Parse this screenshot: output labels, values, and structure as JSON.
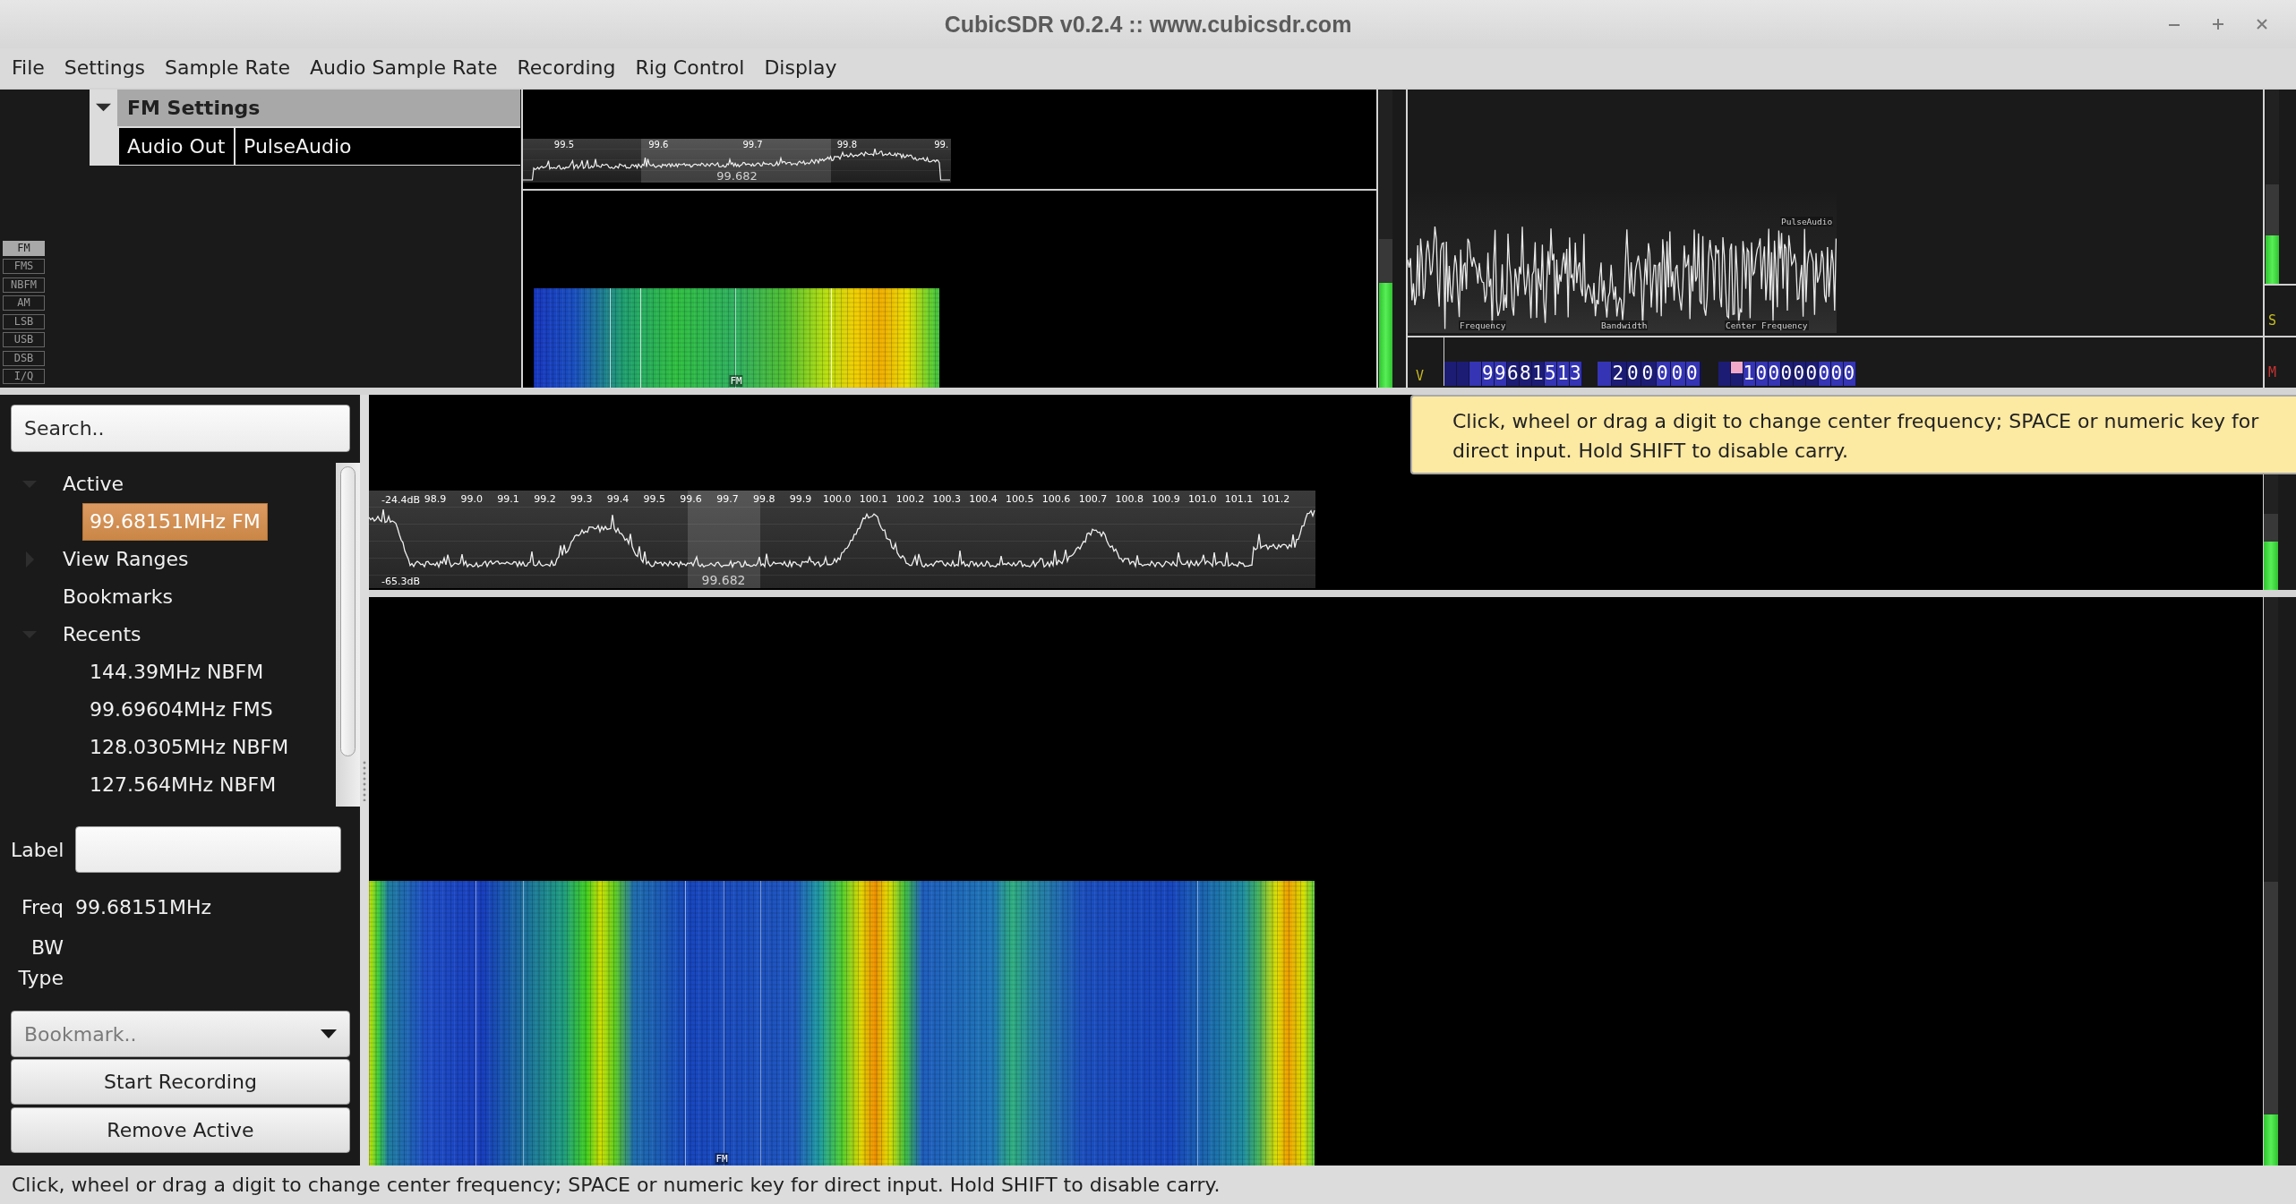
{
  "window": {
    "title": "CubicSDR v0.2.4 :: www.cubicsdr.com"
  },
  "menu": [
    "File",
    "Settings",
    "Sample Rate",
    "Audio Sample Rate",
    "Recording",
    "Rig Control",
    "Display"
  ],
  "demodulator": {
    "modes": [
      {
        "label": "FM",
        "selected": true
      },
      {
        "label": "FMS",
        "selected": false
      },
      {
        "label": "NBFM",
        "selected": false
      },
      {
        "label": "AM",
        "selected": false
      },
      {
        "label": "LSB",
        "selected": false
      },
      {
        "label": "USB",
        "selected": false
      },
      {
        "label": "DSB",
        "selected": false
      },
      {
        "label": "I/Q",
        "selected": false
      }
    ],
    "settings": {
      "title": "FM Settings",
      "expanded": true,
      "rows": [
        {
          "name": "Audio Out",
          "value": "PulseAudio"
        }
      ]
    },
    "spectrum": {
      "ticks": [
        "99.5",
        "99.6",
        "99.7",
        "99.8",
        "99."
      ],
      "center_label": "99.682"
    },
    "waterfall": {
      "marker": "FM"
    },
    "gain_meter": {
      "signal": {
        "level": 0.35
      },
      "setting": {
        "level": 0.5
      }
    },
    "scope": {
      "device": "PulseAudio",
      "labels": [
        "Frequency",
        "Bandwidth",
        "Center Frequency"
      ]
    },
    "toggle_label": "V",
    "displays": [
      {
        "kind": "frequency",
        "value": "99681513",
        "hovered": false
      },
      {
        "kind": "bandwidth",
        "value": "200000",
        "hovered": false
      },
      {
        "kind": "center",
        "value": "100000000",
        "hovered": true
      }
    ],
    "side_meter": {
      "signal": {
        "level": 0.25
      },
      "setting": {
        "level": 0.51
      }
    },
    "side_buttons": [
      {
        "label": "S",
        "color": "#c8c020"
      },
      {
        "label": "M",
        "color": "#c83232"
      }
    ]
  },
  "bookmarks": {
    "search": {
      "placeholder": "Search.."
    },
    "tree": [
      {
        "label": "Active",
        "expanded": true,
        "selected": false,
        "children": [
          {
            "label": "99.68151MHz FM",
            "selected": true
          }
        ]
      },
      {
        "label": "View Ranges",
        "expanded": false,
        "selected": false
      },
      {
        "label": "Bookmarks",
        "selected": false
      },
      {
        "label": "Recents",
        "expanded": true,
        "selected": false,
        "children": [
          {
            "label": "144.39MHz NBFM",
            "selected": false
          },
          {
            "label": "99.69604MHz FMS",
            "selected": false
          },
          {
            "label": "128.0305MHz NBFM",
            "selected": false
          },
          {
            "label": "127.564MHz NBFM",
            "selected": false
          }
        ]
      }
    ],
    "label_field": {
      "label": "Label"
    },
    "info": [
      {
        "label": "Freq",
        "value": "99.68151MHz"
      },
      {
        "label": "BW"
      },
      {
        "label": "Type"
      }
    ],
    "bookmark_menu": {
      "value": "Bookmark..",
      "disabled": true
    },
    "buttons": [
      "Start Recording",
      "Remove Active"
    ]
  },
  "spectrum": {
    "top_label": "-24.4dB",
    "bottom_label": "-65.3dB",
    "ticks": [
      "98.9",
      "99.0",
      "99.1",
      "99.2",
      "99.3",
      "99.4",
      "99.5",
      "99.6",
      "99.7",
      "99.8",
      "99.9",
      "100.0",
      "100.1",
      "100.2",
      "100.3",
      "100.4",
      "100.5",
      "100.6",
      "100.7",
      "100.8",
      "100.9",
      "101.0",
      "101.1",
      "101.2"
    ],
    "center_label": "99.682",
    "meter": {
      "signal": {
        "level": 0.25
      },
      "setting": {
        "level": 0.39
      }
    }
  },
  "waterfall": {
    "marker": "FM",
    "meter": {
      "signal": {
        "level": 0.09
      },
      "setting": {
        "level": 0.5
      }
    }
  },
  "tooltip": "Click, wheel or drag a digit to change center frequency; SPACE or numeric key for direct input.  Hold SHIFT to disable carry.",
  "status_bar": "Click, wheel or drag a digit to change center frequency; SPACE or numeric key for direct input.  Hold SHIFT to disable carry."
}
